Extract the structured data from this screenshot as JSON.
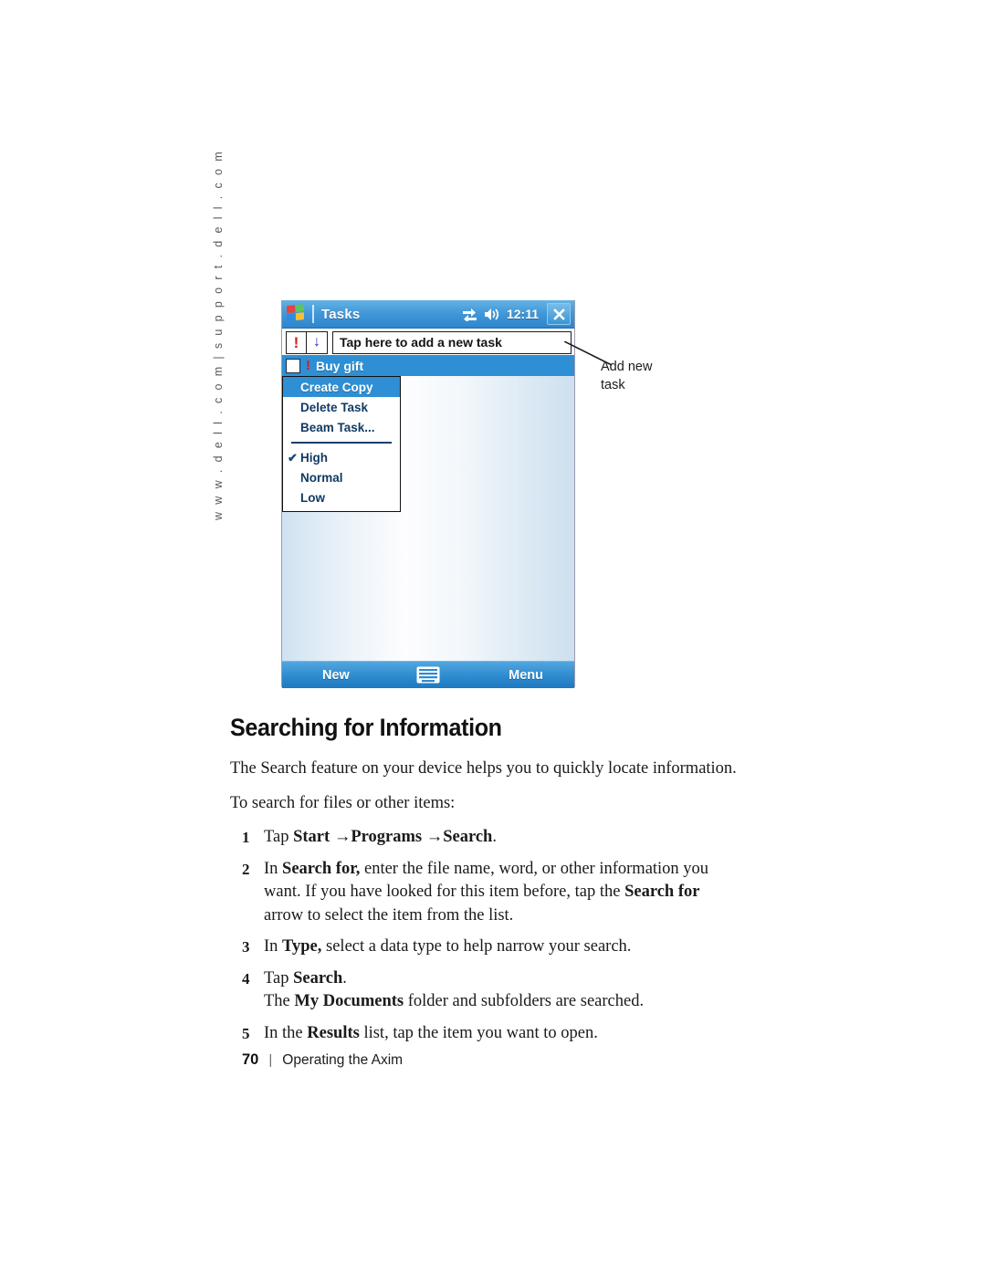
{
  "sidebar": {
    "url_watermark": "w w w . d e l l . c o m   |   s u p p o r t . d e l l . c o m"
  },
  "device": {
    "titlebar": {
      "app_title": "Tasks",
      "clock": "12:11",
      "start_icon": "windows-flag-icon",
      "connectivity_icon": "sync-connectivity-icon",
      "volume_icon": "speaker-volume-icon",
      "close_label": "X"
    },
    "toolbar": {
      "priority_filter_label": "!",
      "sort_filter_label": "↓",
      "new_task_field_text": "Tap here to add a new task"
    },
    "task_row": {
      "label": "Buy gift",
      "priority_marker": "!",
      "checkbox_checked": false
    },
    "context_menu": {
      "items": [
        {
          "label": "Create Copy",
          "selected": true,
          "checked": false
        },
        {
          "label": "Delete Task",
          "selected": false,
          "checked": false
        },
        {
          "label": "Beam Task...",
          "selected": false,
          "checked": false
        }
      ],
      "priority_items": [
        {
          "label": "High",
          "selected": false,
          "checked": true
        },
        {
          "label": "Normal",
          "selected": false,
          "checked": false
        },
        {
          "label": "Low",
          "selected": false,
          "checked": false
        }
      ],
      "check_glyph": "✔"
    },
    "command_bar": {
      "left_label": "New",
      "right_label": "Menu",
      "sip_icon": "keyboard-icon"
    }
  },
  "callout": {
    "line1": "Add new",
    "line2": "task"
  },
  "doc": {
    "heading": "Searching for Information",
    "intro": "The Search feature on your device helps you to quickly locate information.",
    "lead_in": "To search for files or other items:",
    "steps": [
      {
        "num": "1",
        "parts": [
          {
            "t": "Tap ",
            "b": false
          },
          {
            "t": "Start",
            "b": true
          },
          {
            "t": " →",
            "b": false
          },
          {
            "t": "Programs",
            "b": true
          },
          {
            "t": " →",
            "b": false
          },
          {
            "t": "Search",
            "b": true
          },
          {
            "t": ".",
            "b": false
          }
        ]
      },
      {
        "num": "2",
        "parts": [
          {
            "t": "In ",
            "b": false
          },
          {
            "t": "Search for,",
            "b": true
          },
          {
            "t": " enter the file name, word, or other information you want. If you have looked for this item before, tap the ",
            "b": false
          },
          {
            "t": "Search for",
            "b": true
          },
          {
            "t": " arrow to select the item from the list.",
            "b": false
          }
        ]
      },
      {
        "num": "3",
        "parts": [
          {
            "t": "In ",
            "b": false
          },
          {
            "t": "Type,",
            "b": true
          },
          {
            "t": " select a data type to help narrow your search.",
            "b": false
          }
        ]
      },
      {
        "num": "4",
        "parts": [
          {
            "t": "Tap ",
            "b": false
          },
          {
            "t": "Search",
            "b": true
          },
          {
            "t": ".",
            "b": false
          },
          {
            "t": "\n",
            "b": false
          },
          {
            "t": "The ",
            "b": false
          },
          {
            "t": "My Documents",
            "b": true
          },
          {
            "t": " folder and subfolders are searched.",
            "b": false
          }
        ]
      },
      {
        "num": "5",
        "parts": [
          {
            "t": "In the ",
            "b": false
          },
          {
            "t": "Results",
            "b": true
          },
          {
            "t": " list, tap the item you want to open.",
            "b": false
          }
        ]
      }
    ]
  },
  "footer": {
    "page_number": "70",
    "separator": "|",
    "section": "Operating the Axim"
  },
  "colors": {
    "accent_blue": "#2e8fd4",
    "title_blue": "#3f95d6",
    "menu_text": "#113a63",
    "priority_red": "#d81c1c",
    "sort_blue": "#2a2ad0"
  }
}
